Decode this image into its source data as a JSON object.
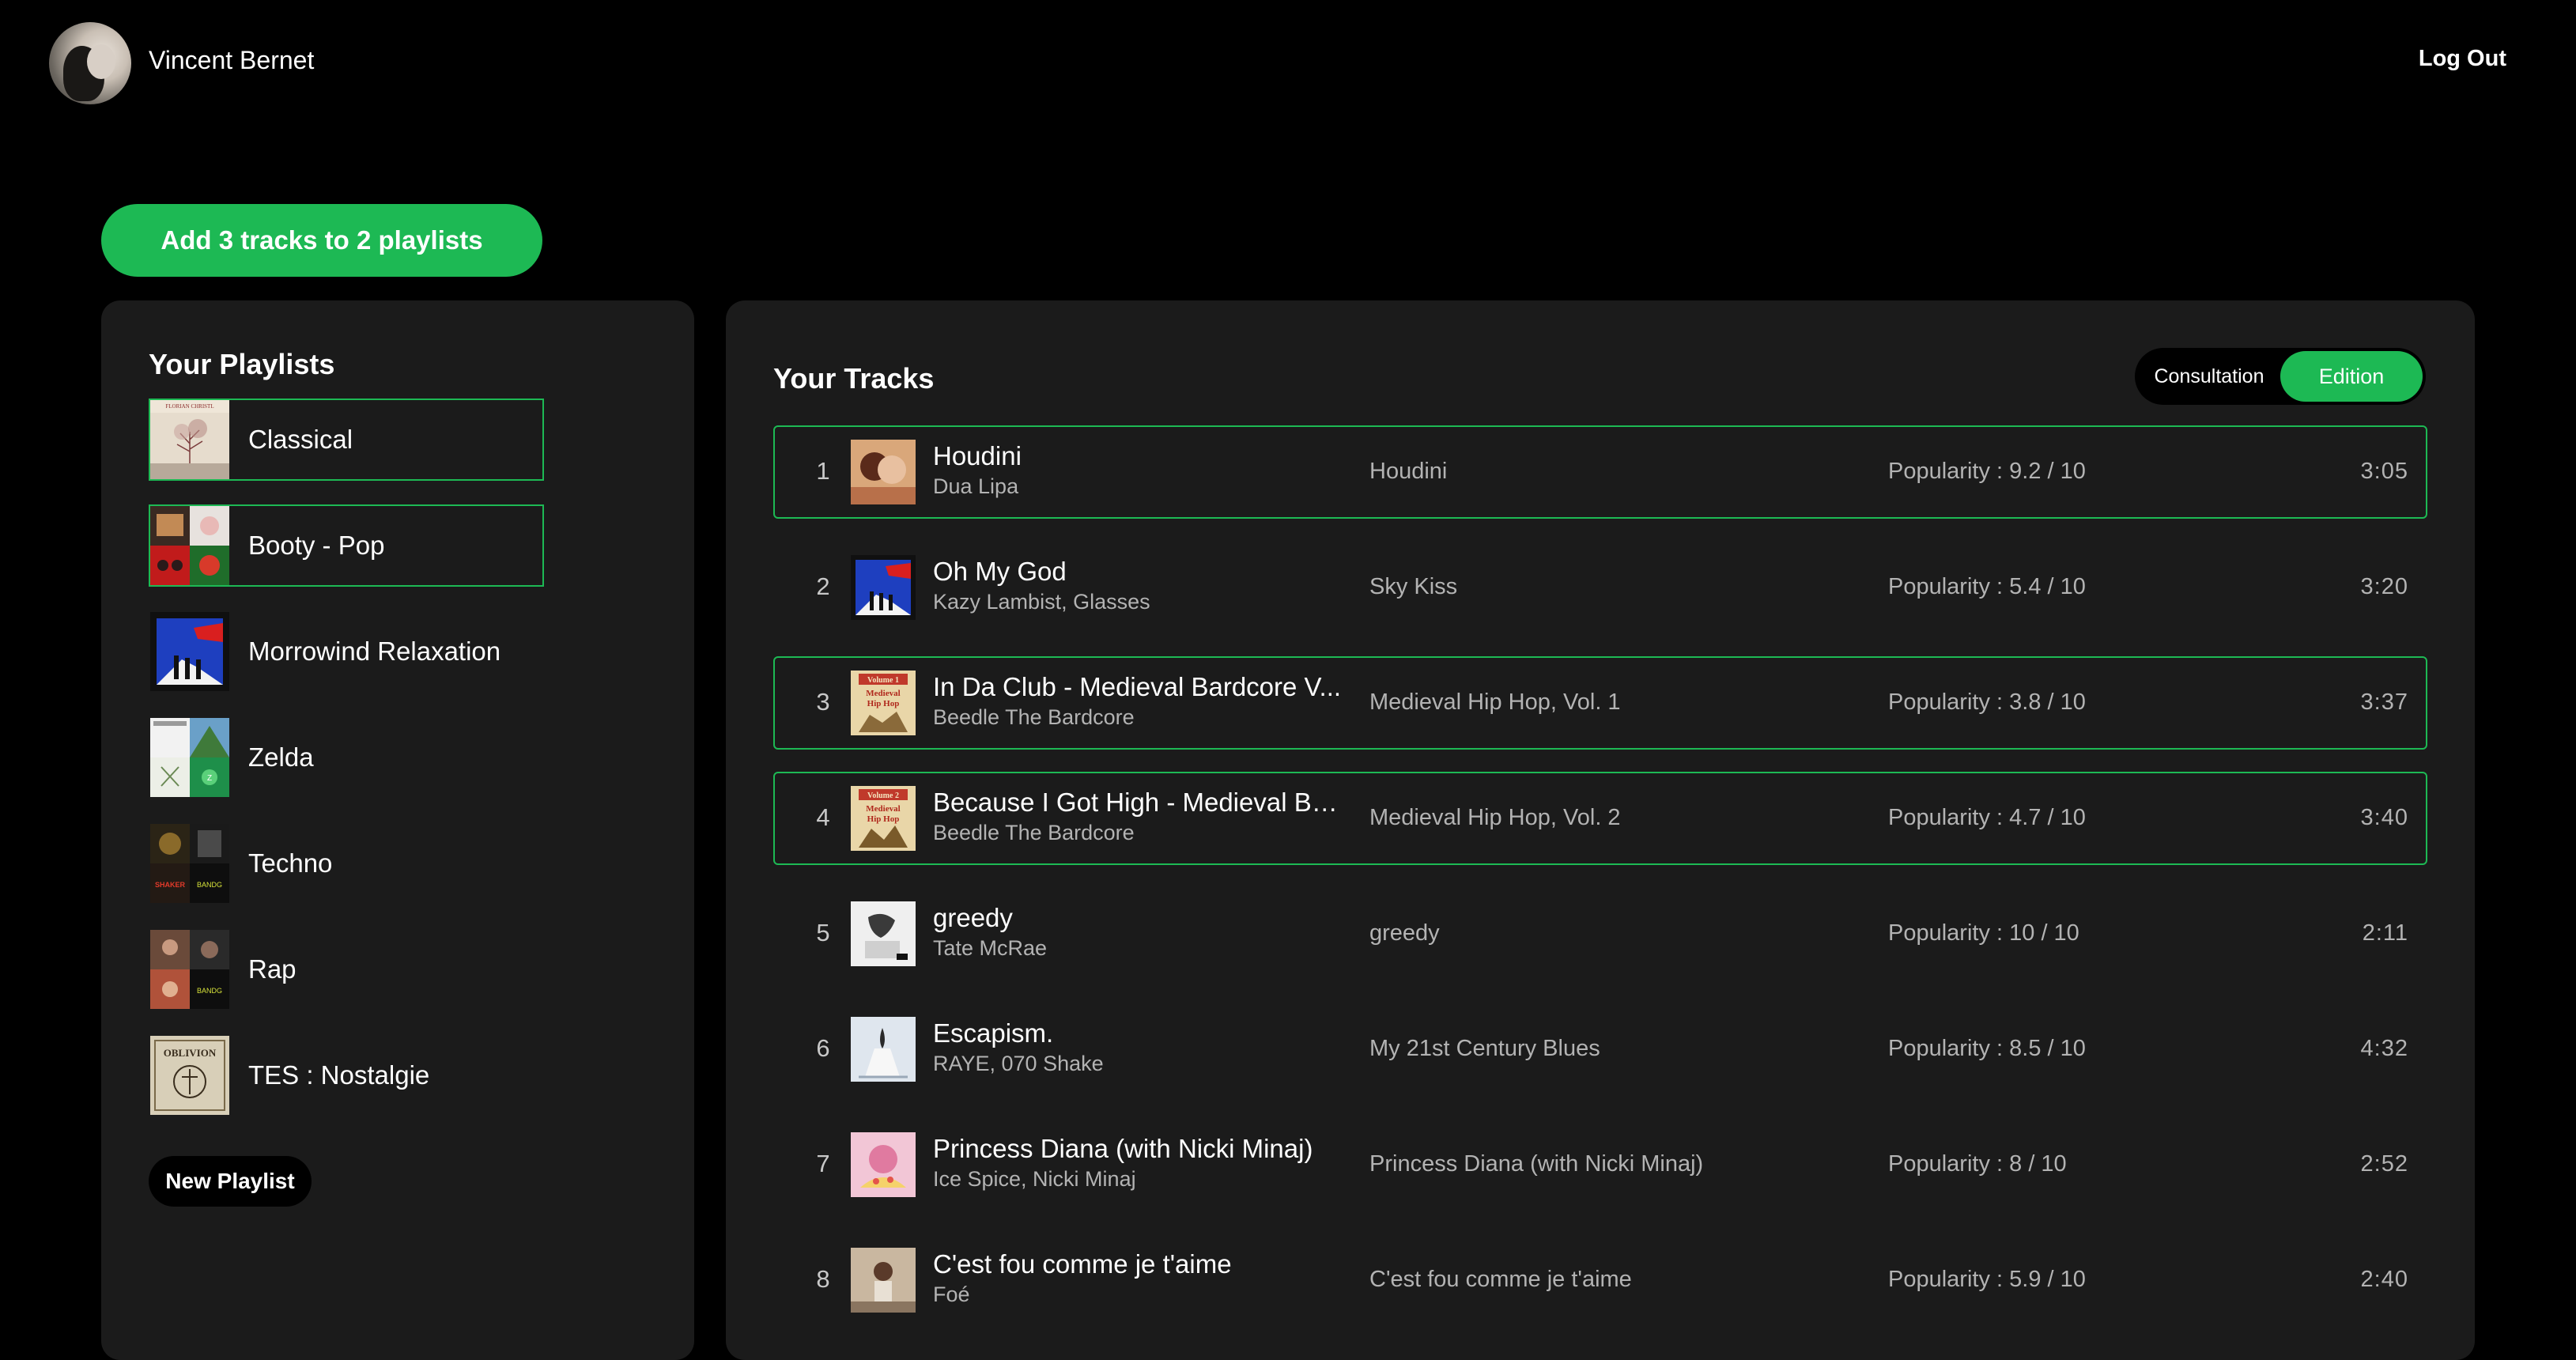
{
  "header": {
    "user_name": "Vincent Bernet",
    "logout_label": "Log Out"
  },
  "actions": {
    "add_label": "Add 3 tracks to 2 playlists"
  },
  "playlists": {
    "title": "Your Playlists",
    "new_label": "New Playlist",
    "items": [
      {
        "name": "Classical",
        "selected": true
      },
      {
        "name": "Booty - Pop",
        "selected": true
      },
      {
        "name": "Morrowind Relaxation",
        "selected": false
      },
      {
        "name": "Zelda",
        "selected": false
      },
      {
        "name": "Techno",
        "selected": false
      },
      {
        "name": "Rap",
        "selected": false
      },
      {
        "name": "TES : Nostalgie",
        "selected": false
      }
    ]
  },
  "tracks": {
    "title": "Your Tracks",
    "mode_consultation": "Consultation",
    "mode_edition": "Edition",
    "active_mode": "Edition",
    "items": [
      {
        "num": "1",
        "title": "Houdini",
        "artist": "Dua Lipa",
        "album": "Houdini",
        "popularity": "Popularity : 9.2 / 10",
        "duration": "3:05",
        "selected": true
      },
      {
        "num": "2",
        "title": "Oh My God",
        "artist": "Kazy Lambist, Glasses",
        "album": "Sky Kiss",
        "popularity": "Popularity : 5.4 / 10",
        "duration": "3:20",
        "selected": false
      },
      {
        "num": "3",
        "title": "In Da Club - Medieval Bardcore V...",
        "artist": "Beedle The Bardcore",
        "album": "Medieval Hip Hop, Vol. 1",
        "popularity": "Popularity : 3.8 / 10",
        "duration": "3:37",
        "selected": true
      },
      {
        "num": "4",
        "title": "Because I Got High - Medieval Bar...",
        "artist": "Beedle The Bardcore",
        "album": "Medieval Hip Hop, Vol. 2",
        "popularity": "Popularity : 4.7 / 10",
        "duration": "3:40",
        "selected": true
      },
      {
        "num": "5",
        "title": "greedy",
        "artist": "Tate McRae",
        "album": "greedy",
        "popularity": "Popularity : 10 / 10",
        "duration": "2:11",
        "selected": false
      },
      {
        "num": "6",
        "title": "Escapism.",
        "artist": "RAYE, 070 Shake",
        "album": "My 21st Century Blues",
        "popularity": "Popularity : 8.5 / 10",
        "duration": "4:32",
        "selected": false
      },
      {
        "num": "7",
        "title": "Princess Diana (with Nicki Minaj)",
        "artist": "Ice Spice, Nicki Minaj",
        "album": "Princess Diana (with Nicki Minaj)",
        "popularity": "Popularity : 8 / 10",
        "duration": "2:52",
        "selected": false
      },
      {
        "num": "8",
        "title": "C'est fou comme je t'aime",
        "artist": "Foé",
        "album": "C'est fou comme je t'aime",
        "popularity": "Popularity : 5.9 / 10",
        "duration": "2:40",
        "selected": false
      }
    ]
  },
  "colors": {
    "accent": "#1db954",
    "background": "#000000",
    "panel": "#1b1b1b"
  }
}
